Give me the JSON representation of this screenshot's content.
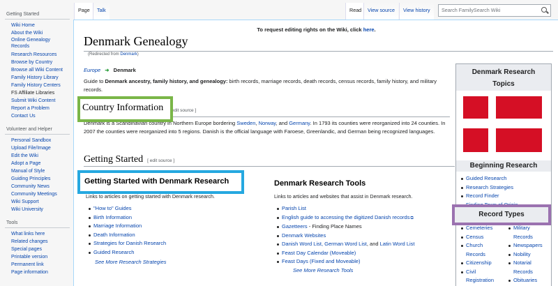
{
  "sidebar": {
    "sections": [
      {
        "title": "Getting Started",
        "items": [
          "Wiki Home",
          "About the Wiki",
          "Online Genealogy Records",
          "Research Resources",
          "Browse by Country",
          "Browse all Wiki Content",
          "Family History Library",
          "Family History Centers",
          "FS Affiliate Libraries",
          "Submit Wiki Content",
          "Report a Problem",
          "Contact Us"
        ]
      },
      {
        "title": "Volunteer and Helper",
        "items": [
          "Personal Sandbox",
          "Upload File/Image",
          "Edit the Wiki",
          "Adopt a Page",
          "Manual of Style",
          "Guiding Principles",
          "Community News",
          "Community Meetings",
          "Wiki Support",
          "Wiki University"
        ]
      },
      {
        "title": "Tools",
        "items": [
          "What links here",
          "Related changes",
          "Special pages",
          "Printable version",
          "Permanent link",
          "Page information"
        ]
      }
    ]
  },
  "tabs": {
    "page": "Page",
    "talk": "Talk",
    "read": "Read",
    "view_source": "View source",
    "view_history": "View history"
  },
  "search": {
    "placeholder": "Search FamilySearch Wiki"
  },
  "notice": {
    "text": "To request editing rights on the Wiki, click ",
    "link": "here",
    "end": "."
  },
  "page": {
    "title": "Denmark Genealogy",
    "redirect_prefix": "(Redirected from ",
    "redirect_link": "Denmark",
    "redirect_suffix": ")",
    "breadcrumb_parent": "Europe",
    "breadcrumb_current": "Denmark",
    "intro_pre": "Guide to ",
    "intro_bold": "Denmark ancestry, family history, and genealogy:",
    "intro_rest": " birth records, marriage records, death records, census records, family history, and military records."
  },
  "country_info": {
    "heading": "Country Information",
    "edit": "[ edit source ]",
    "p1": "Denmark is a Scandinavian country in Northern Europe bordering ",
    "l1": "Sweden",
    "s1": ", ",
    "l2": "Norway",
    "s2": ", and ",
    "l3": "Germany",
    "p2": ". In 1793 its counties were reorganized into 24 counties. In 2007 the counties were reorganized into 5 regions. Danish is the official language with Faroese, Greenlandic, and German being recognized languages."
  },
  "getting_started": {
    "heading": "Getting Started",
    "edit": "[ edit source ]",
    "left": {
      "heading": "Getting Started with Denmark Research",
      "desc": "Links to articles on getting started with Denmark research.",
      "items": [
        "\"How to\" Guides",
        "Birth Information",
        "Marriage Information",
        "Death Information",
        "Strategies for Danish Research",
        "Guided Research"
      ],
      "more": "See More Research Strategies"
    },
    "right": {
      "heading": "Denmark Research Tools",
      "desc": "Links to articles and websites that assist in Denmark research.",
      "items": [
        "Parish List",
        "English guide to accessing the digitized Danish records",
        "Gazetteers",
        "Denmark Websites",
        "Danish Word List, German Word List",
        "Feast Day Calendar (Moveable)",
        "Feast Days (Fixed and Moveable)"
      ],
      "gazetteers_suffix": " - Finding Place Names",
      "wordlist_mid": ", and ",
      "wordlist_last": "Latin Word List",
      "more": "See More Research Tools"
    }
  },
  "infobox": {
    "title": "Denmark Research Topics",
    "beginning_title": "Beginning Research",
    "beginning_items": [
      "Guided Research",
      "Research Strategies",
      "Record Finder",
      "Finding Town of Origin"
    ],
    "record_types_title": "Record Types",
    "col1": [
      "Cemeteries",
      "Census",
      "Church Records",
      "Citizenship",
      "Civil Registration"
    ],
    "col2": [
      "Military Records",
      "Newspapers",
      "Nobility",
      "Notarial Records",
      "Obituaries"
    ]
  },
  "colors": {
    "flag_red": "#d50f25",
    "highlight_green": "#7ab648",
    "highlight_blue": "#25a8e0",
    "highlight_purple": "#9b72b0",
    "link": "#0645ad"
  }
}
